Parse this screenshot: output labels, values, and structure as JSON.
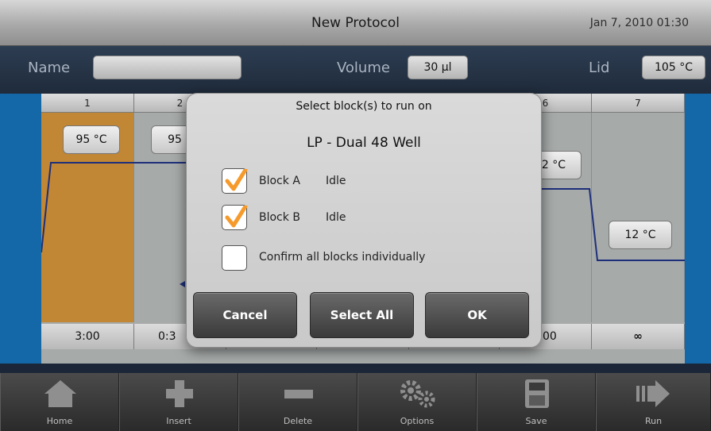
{
  "header": {
    "title": "New Protocol",
    "clock": "Jan 7, 2010 01:30"
  },
  "info": {
    "name_label": "Name",
    "name_value": "",
    "volume_label": "Volume",
    "volume_value": "30 µl",
    "lid_label": "Lid",
    "lid_value": "105 °C"
  },
  "protocol": {
    "columns": [
      "1",
      "2",
      "",
      "",
      "",
      "6",
      "7"
    ],
    "temps": [
      "95 °C",
      "95",
      "2 °C",
      "12 °C"
    ],
    "times": [
      "3:00",
      "0:3",
      "00",
      "∞"
    ]
  },
  "dialog": {
    "title": "Select block(s) to run on",
    "subtitle": "LP - Dual 48 Well",
    "options": [
      {
        "label": "Block A",
        "status": "Idle",
        "checked": true
      },
      {
        "label": "Block B",
        "status": "Idle",
        "checked": true
      },
      {
        "label": "Confirm all blocks individually",
        "status": "",
        "checked": false
      }
    ],
    "buttons": {
      "cancel": "Cancel",
      "select_all": "Select All",
      "ok": "OK"
    }
  },
  "toolbar": {
    "home": "Home",
    "insert": "Insert",
    "delete": "Delete",
    "options": "Options",
    "save": "Save",
    "run": "Run"
  },
  "colors": {
    "accent_blue": "#1468a8",
    "step_orange": "#c18735",
    "check_orange": "#f59a2b"
  }
}
